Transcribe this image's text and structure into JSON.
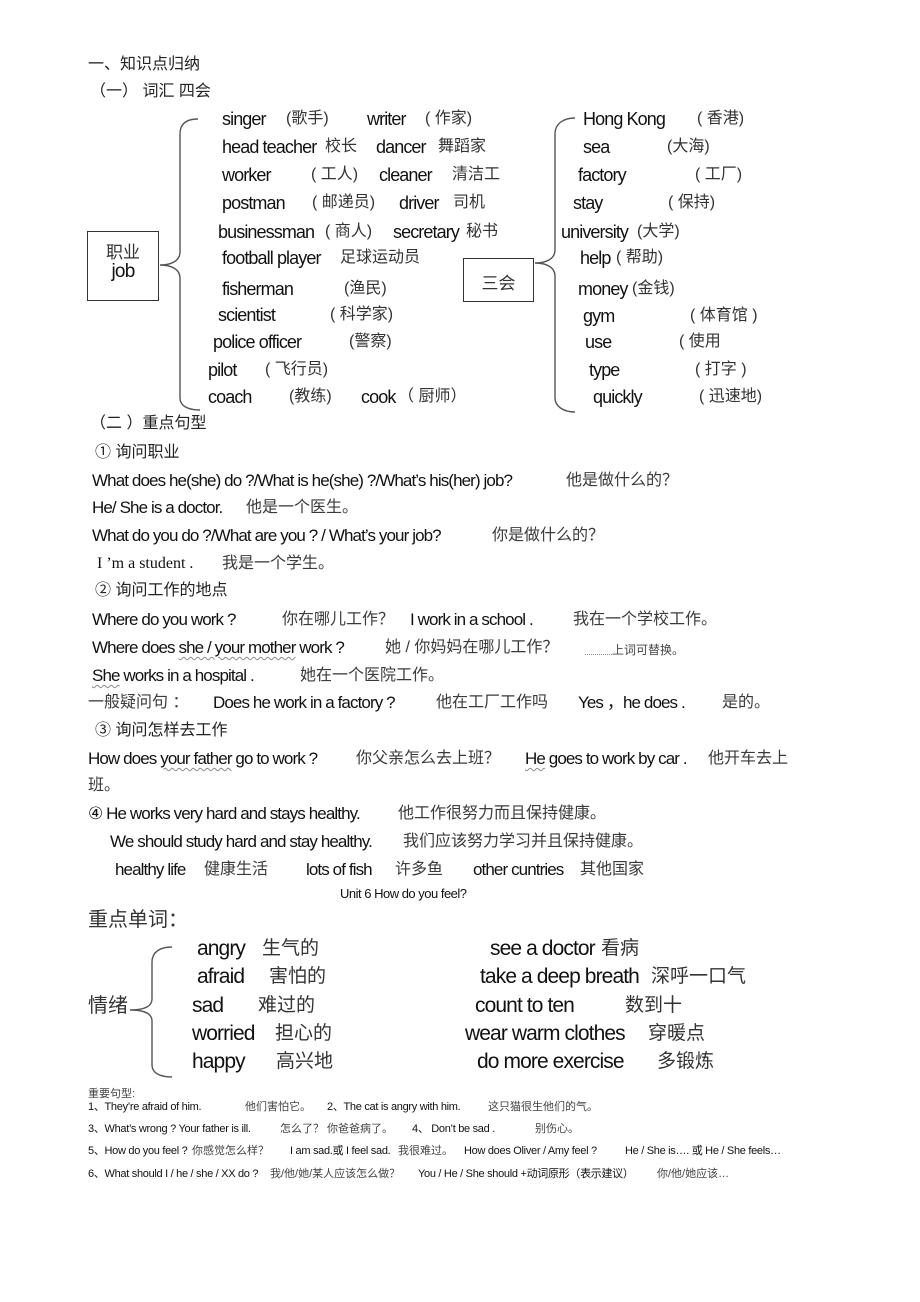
{
  "heading": "一、知识点归纳",
  "vocab": {
    "title": "（一） 词汇  四会",
    "job_box": {
      "cn": "职业",
      "en": "job"
    },
    "jobs": [
      {
        "en": "singer",
        "cn": "(歌手)",
        "en2": "writer",
        "cn2": "( 作家)"
      },
      {
        "en": "head  teacher",
        "cn": "校长",
        "en2": "dancer",
        "cn2": "舞蹈家"
      },
      {
        "en": "worker",
        "cn": "( 工人)",
        "en2": "cleaner",
        "cn2": "清洁工"
      },
      {
        "en": "postman",
        "cn": "( 邮递员)",
        "en2": "driver",
        "cn2": "司机"
      },
      {
        "en": "businessman",
        "cn": "( 商人)",
        "en2": "secretary",
        "cn2": "秘书"
      },
      {
        "en": "football player",
        "cn": "足球运动员"
      },
      {
        "en": "fisherman",
        "cn": "(渔民)"
      },
      {
        "en": "scientist",
        "cn": "( 科学家)"
      },
      {
        "en": "police officer",
        "cn": "(警察)"
      },
      {
        "en": "pilot",
        "cn": "( 飞行员)"
      },
      {
        "en": "coach",
        "cn": "(教练)",
        "en2": "cook",
        "cn2": "（ 厨师）"
      }
    ],
    "sanhui_box": "三会",
    "sanhui": [
      {
        "en": "Hong Kong",
        "cn": "( 香港)"
      },
      {
        "en": "sea",
        "cn": "(大海)"
      },
      {
        "en": "factory",
        "cn": "( 工厂)"
      },
      {
        "en": "stay",
        "cn": "( 保持)"
      },
      {
        "en": "university",
        "cn": "(大学)"
      },
      {
        "en": "help",
        "cn": "( 帮助)"
      },
      {
        "en": "money",
        "cn": "(金钱)"
      },
      {
        "en": "gym",
        "cn": "( 体育馆 )"
      },
      {
        "en": "use",
        "cn": "( 使用"
      },
      {
        "en": "type",
        "cn": "( 打字 )"
      },
      {
        "en": "quickly",
        "cn": "( 迅速地)"
      }
    ]
  },
  "patterns": {
    "title": "（二 ）重点句型",
    "s1_title": "① 询问职业",
    "l1_en": "What does he(she) do ?/What is he(she) ?/What’s his(her) job?",
    "l1_cn": "他是做什么的？",
    "l2_en": "He/ She is a doctor.",
    "l2_cn": "他是一个医生。",
    "l3_en": "What do you do ?/What are you ? / What’s your job?",
    "l3_cn": "你是做什么的？",
    "l4_en": "I ’m a student .",
    "l4_cn": "我是一个学生。",
    "s2_title": "② 询问工作的地点",
    "l5_en": "Where do you work ?",
    "l5_cn": "你在哪儿工作？",
    "l5_en2": "I work in a school .",
    "l5_cn2": "我在一个学校工作。",
    "l6_en_a": "Where does ",
    "l6_en_b": "she / your mother",
    "l6_en_c": "  work ?",
    "l6_cn": "她 / 你妈妈在哪儿工作？",
    "l6_note": "上词可替换。",
    "l7_en_a": "She",
    "l7_en_b": " works in a hospital .",
    "l7_cn": "她在一个医院工作。",
    "l8_label": "一般疑问句 ：",
    "l8_en": "Does  he work in a factory ?",
    "l8_cn": "他在工厂工作吗",
    "l8_en2": "Yes ，he does .",
    "l8_cn2": "是的。",
    "s3_title": "③ 询问怎样去工作",
    "l9_en_a": "How does ",
    "l9_en_b": "your father",
    "l9_en_c": " go to work ?",
    "l9_cn": "你父亲怎么去上班？",
    "l9_en2_a": "He",
    "l9_en2_b": " goes to work by car .",
    "l9_cn2": "他开车去上",
    "l10_cn": "班。",
    "l11_en": "④ He works very hard and stays healthy.",
    "l11_cn": "他工作很努力而且保持健康。",
    "l12_en": "We should study hard and stay healthy.",
    "l12_cn": "我们应该努力学习并且保持健康。",
    "phrases": [
      {
        "en": "healthy life",
        "cn": "健康生活"
      },
      {
        "en": "lots of fish",
        "cn": "许多鱼"
      },
      {
        "en": "other cuntries",
        "cn": "其他国家"
      }
    ]
  },
  "unit6": {
    "title": "Unit 6 How do you feel?",
    "key_words_title": "重点单词：",
    "emotion_label": "情绪",
    "emotions": [
      {
        "en": "angry",
        "cn": "生气的"
      },
      {
        "en": "afraid",
        "cn": "害怕的"
      },
      {
        "en": "sad",
        "cn": "难过的"
      },
      {
        "en": "worried",
        "cn": "担心的"
      },
      {
        "en": "happy",
        "cn": "高兴地"
      }
    ],
    "phrases": [
      {
        "en": "see a doctor",
        "cn": "看病"
      },
      {
        "en": "take a deep breath",
        "cn": "深呼一口气"
      },
      {
        "en": "count to ten",
        "cn": "数到十"
      },
      {
        "en": "wear  warm  clothes",
        "cn": "穿暖点"
      },
      {
        "en": "do more  exercise",
        "cn": "多锻炼"
      }
    ],
    "sentences_title": "重要句型:",
    "s1_en": "1、They’re   afraid   of   him.",
    "s1_cn": "他们害怕它。",
    "s2_en": "2、The cat is angry with him.",
    "s2_cn": "这只猫很生他们的气。",
    "s3_en": "3、What’s  wrong ?    Your  father is ill.",
    "s3_cn": "怎么了？ 你爸爸病了。",
    "s4_en": "4、 Don’t  be  sad .",
    "s4_cn": "别伤心。",
    "s5_en": "5、How do you feel ?",
    "s5_cn": "你感觉怎么样？",
    "s5_en2": "I am sad.或 I feel sad.",
    "s5_cn2": "我很难过。",
    "s5_en3": "How does Oliver / Amy  feel ?",
    "s5_en4": "He / She is…. 或 He / She feels…",
    "s6_en": "6、What should I / he / she / XX do ?",
    "s6_cn": "我/他/她/某人应该怎么做？",
    "s6_en2": "You / He / She should  +动词原形（表示建议）",
    "s6_cn2": "你/他/她应该…"
  }
}
